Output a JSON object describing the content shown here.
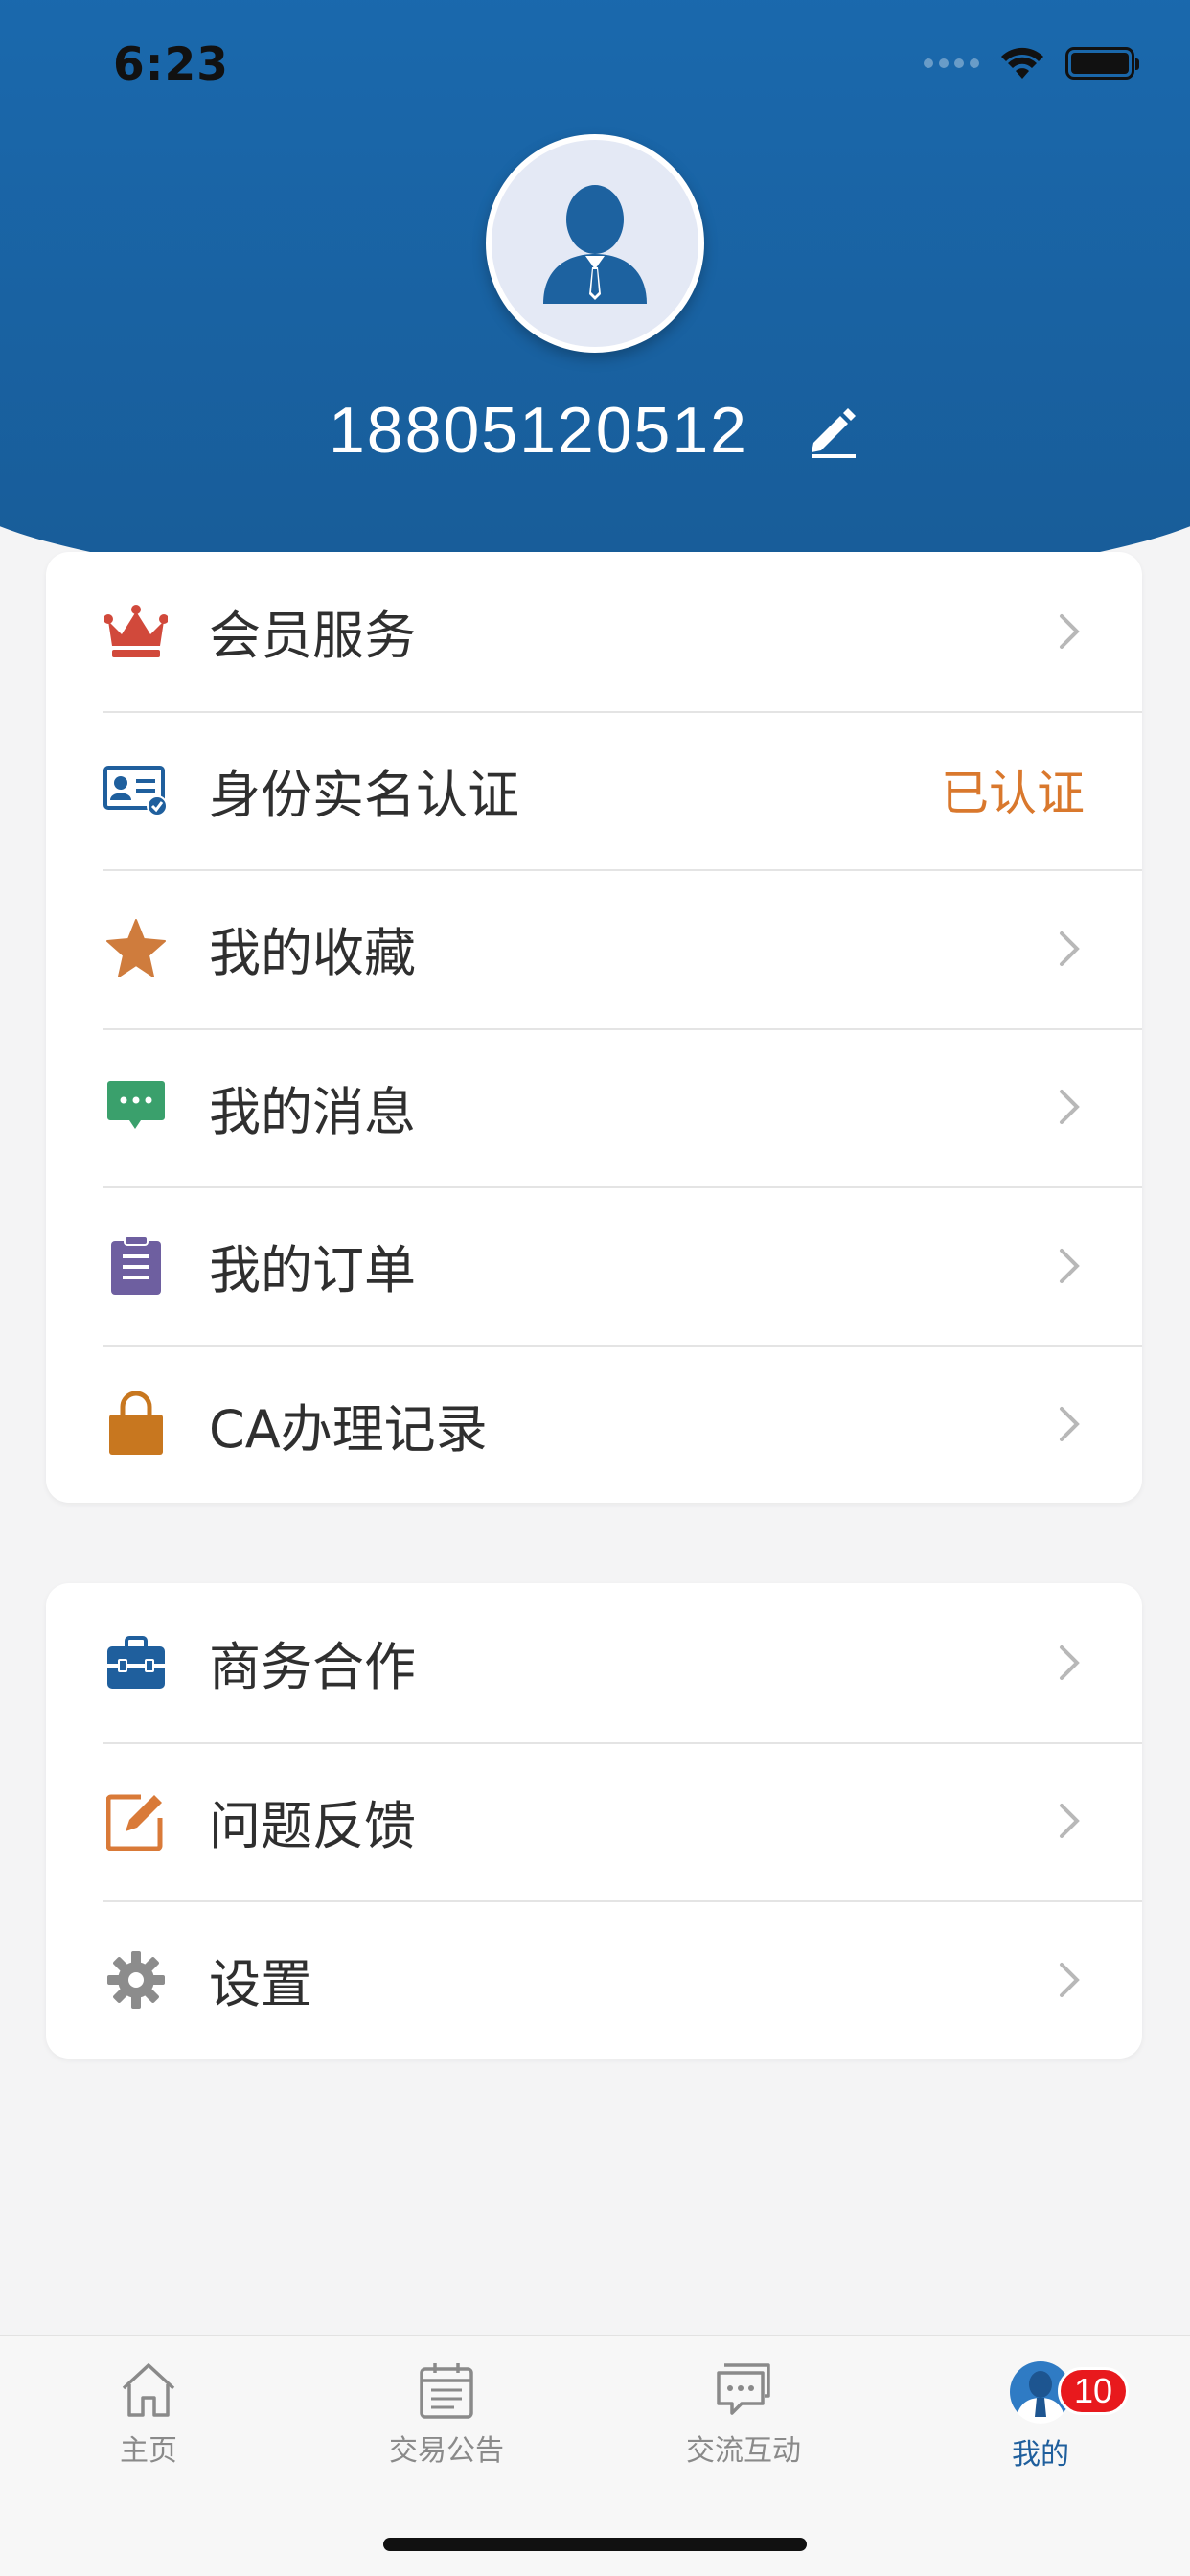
{
  "status_bar": {
    "time": "6:23"
  },
  "profile": {
    "phone": "18805120512"
  },
  "menu_group_1": [
    {
      "label": "会员服务",
      "icon": "crown-icon",
      "status": ""
    },
    {
      "label": "身份实名认证",
      "icon": "id-card-verified-icon",
      "status": "已认证"
    },
    {
      "label": "我的收藏",
      "icon": "star-icon",
      "status": ""
    },
    {
      "label": "我的消息",
      "icon": "message-bubble-icon",
      "status": ""
    },
    {
      "label": "我的订单",
      "icon": "clipboard-list-icon",
      "status": ""
    },
    {
      "label": "CA办理记录",
      "icon": "lock-bag-icon",
      "status": ""
    }
  ],
  "menu_group_2": [
    {
      "label": "商务合作",
      "icon": "briefcase-icon"
    },
    {
      "label": "问题反馈",
      "icon": "edit-note-icon"
    },
    {
      "label": "设置",
      "icon": "gear-icon"
    }
  ],
  "tabbar": {
    "tabs": [
      {
        "label": "主页",
        "icon": "home-icon"
      },
      {
        "label": "交易公告",
        "icon": "calendar-list-icon"
      },
      {
        "label": "交流互动",
        "icon": "chat-bubbles-icon"
      },
      {
        "label": "我的",
        "icon": "user-avatar-icon",
        "badge": "10",
        "active": true
      }
    ]
  },
  "colors": {
    "header_blue_top": "#2a8bd8",
    "header_blue_bottom": "#185c98",
    "verified_orange": "#d9782d",
    "active_tab": "#1f5f9d",
    "badge_red": "#e8191d"
  }
}
